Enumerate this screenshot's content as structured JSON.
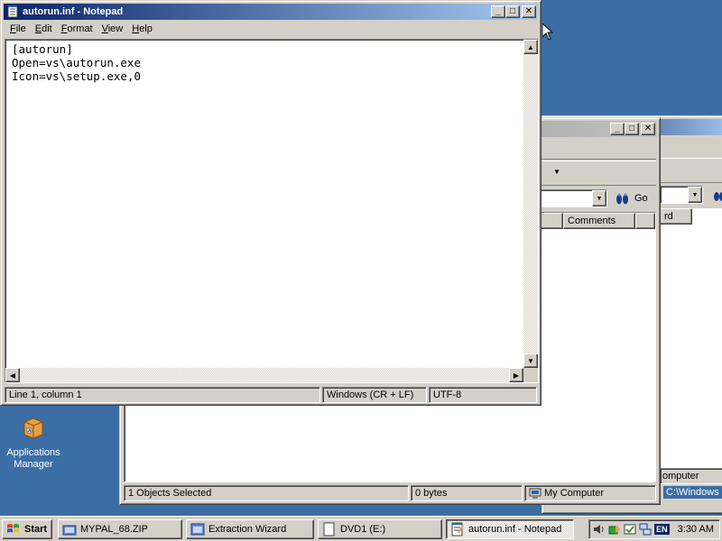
{
  "notepad": {
    "title": "autorun.inf - Notepad",
    "menu": [
      {
        "label": "File",
        "accel": "F",
        "rest": "ile"
      },
      {
        "label": "Edit",
        "accel": "E",
        "rest": "dit"
      },
      {
        "label": "Format",
        "accel": "F",
        "rest": "ormat"
      },
      {
        "label": "View",
        "accel": "V",
        "rest": "iew"
      },
      {
        "label": "Help",
        "accel": "H",
        "rest": "elp"
      }
    ],
    "content": "[autorun]\nOpen=vs\\autorun.exe\nIcon=vs\\setup.exe,0",
    "status": {
      "position": "Line 1, column 1",
      "line_endings": "Windows (CR + LF)",
      "encoding": "UTF-8"
    }
  },
  "explorer_front": {
    "go_label": "Go",
    "column_comments": "Comments",
    "status": {
      "selected": "1 Objects Selected",
      "size": "0 bytes",
      "location": "My Computer"
    }
  },
  "explorer_back": {
    "column_partial": "rd",
    "status_partial": "omputer",
    "path_partial": "C:\\Windows"
  },
  "desktop": {
    "icon_label_line1": "Applications",
    "icon_label_line2": "Manager"
  },
  "taskbar": {
    "start_label": "Start",
    "buttons": [
      {
        "label": "MYPAL_68.ZIP",
        "icon": "folder-icon"
      },
      {
        "label": "Extraction Wizard",
        "icon": "window-icon"
      },
      {
        "label": "DVD1 (E:)",
        "icon": "drive-icon"
      },
      {
        "label": "autorun.inf - Notepad",
        "icon": "notepad-icon"
      }
    ],
    "language": "EN",
    "clock": "3:30 AM"
  },
  "colors": {
    "desktop": "#3a6ea5",
    "title_active": "#0a246a",
    "face": "#d4d0c8"
  }
}
